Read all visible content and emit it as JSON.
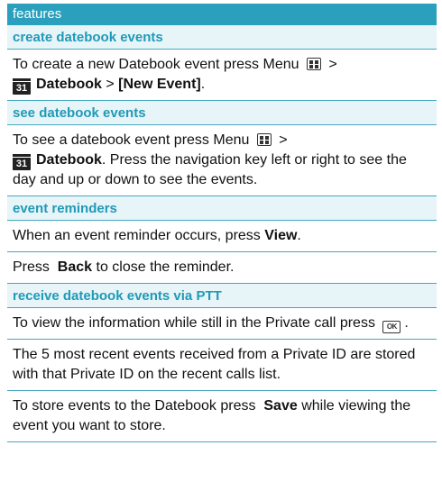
{
  "header": {
    "title": "features"
  },
  "sections": [
    {
      "heading": "create datebook events",
      "p1_a": "To create a new Datebook event press Menu",
      "p1_b": ">",
      "datebook": "Datebook",
      "sep": ">",
      "new_event": "[New Event]",
      "end": "."
    },
    {
      "heading": "see datebook events",
      "p1_a": "To see a datebook event press Menu",
      "p1_b": ">",
      "datebook": "Datebook",
      "rest": ". Press the navigation key left or right to see the day and up or down to see the events."
    },
    {
      "heading": "event reminders",
      "p1_a": "When an event reminder occurs, press",
      "view": "View",
      "p1_end": ".",
      "p2_a": "Press",
      "back": "Back",
      "p2_b": "to close the reminder."
    },
    {
      "heading": "receive datebook events via PTT",
      "p1_a": "To view the information while still in the Private call press",
      "p1_end": ".",
      "p2": "The 5 most recent events received from a Private ID are stored with that Private ID on the recent calls list.",
      "p3_a": "To store events to the Datebook press",
      "save": "Save",
      "p3_b": "while viewing the event you want to store."
    }
  ],
  "icons": {
    "menu": "menu-key-icon",
    "calendar": "calendar-31-icon",
    "ok": "ok-key-icon",
    "calendar_day": "31",
    "ok_label": "OK"
  },
  "colors": {
    "header_bg": "#2aa0bd",
    "subhead_bg": "#e7f4f8",
    "subhead_text": "#1f9ab8",
    "rule": "#43a8c0"
  }
}
